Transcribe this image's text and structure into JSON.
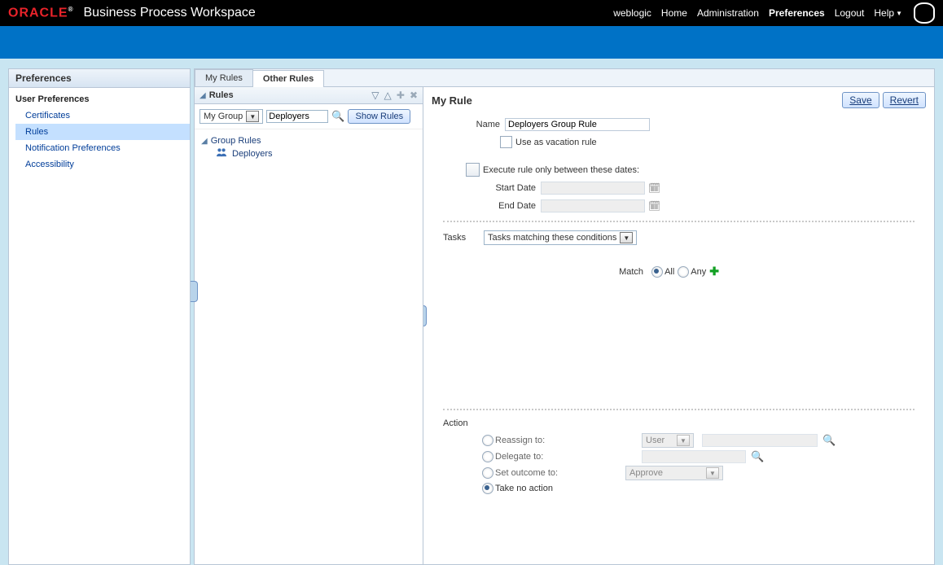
{
  "brand": "ORACLE",
  "app_title": "Business Process Workspace",
  "user": "weblogic",
  "nav": {
    "home": "Home",
    "admin": "Administration",
    "prefs": "Preferences",
    "logout": "Logout",
    "help": "Help"
  },
  "left": {
    "panel_title": "Preferences",
    "section": "User Preferences",
    "items": [
      "Certificates",
      "Rules",
      "Notification Preferences",
      "Accessibility"
    ],
    "selected": 1
  },
  "tabs": {
    "my": "My Rules",
    "other": "Other Rules"
  },
  "rules": {
    "header": "Rules",
    "scope_options": [
      "My Group"
    ],
    "search_value": "Deployers",
    "show_rules_btn": "Show Rules",
    "tree": {
      "root": "Group Rules",
      "child": "Deployers"
    }
  },
  "rule": {
    "title": "My Rule",
    "save": "Save",
    "revert": "Revert",
    "name_label": "Name",
    "name_value": "Deployers Group Rule",
    "vacation_label": "Use as vacation rule",
    "between_dates_label": "Execute rule only between these dates:",
    "start_label": "Start Date",
    "end_label": "End Date",
    "tasks_label": "Tasks",
    "tasks_mode": "Tasks matching these conditions",
    "match_label": "Match",
    "match_all": "All",
    "match_any": "Any",
    "action_label": "Action",
    "actions": {
      "reassign": "Reassign to:",
      "delegate": "Delegate to:",
      "outcome": "Set outcome to:",
      "none": "Take no action"
    },
    "user_dd": "User",
    "approve_dd": "Approve"
  }
}
